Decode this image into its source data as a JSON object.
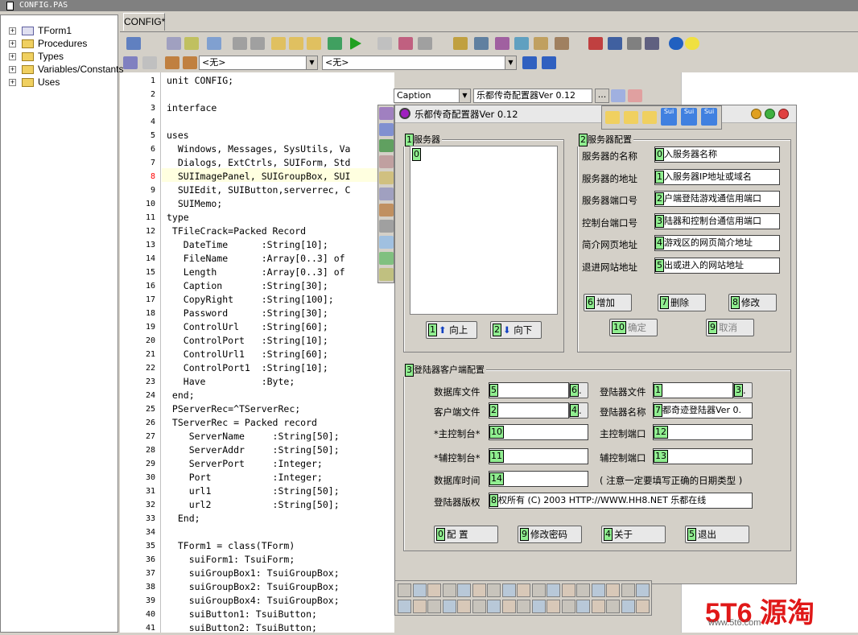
{
  "window": {
    "title": "CONFIG.PAS"
  },
  "tree": {
    "items": [
      "TForm1",
      "Procedures",
      "Types",
      "Variables/Constants",
      "Uses"
    ]
  },
  "tabs": {
    "active": "CONFIG*"
  },
  "combos": {
    "left": "<无>",
    "right": "<无>"
  },
  "code": {
    "line_numbers": [
      "1",
      "2",
      "3",
      "4",
      "5",
      "6",
      "7",
      "8",
      "9",
      "10",
      "11",
      "12",
      "13",
      "14",
      "15",
      "16",
      "17",
      "18",
      "19",
      "20",
      "21",
      "22",
      "23",
      "24",
      "25",
      "26",
      "27",
      "28",
      "29",
      "30",
      "31",
      "32",
      "33",
      "34",
      "35",
      "36",
      "37",
      "38",
      "39",
      "40",
      "41"
    ],
    "lines": [
      "unit CONFIG;",
      "",
      "interface",
      "",
      "uses",
      "  Windows, Messages, SysUtils, Va",
      "  Dialogs, ExtCtrls, SUIForm, Std",
      "  SUIImagePanel, SUIGroupBox, SUI",
      "  SUIEdit, SUIButton,serverrec, C",
      "  SUIMemo;",
      "type",
      " TFileCrack=Packed Record",
      "   DateTime      :String[10];",
      "   FileName      :Array[0..3] of",
      "   Length        :Array[0..3] of",
      "   Caption       :String[30];",
      "   CopyRight     :String[100];",
      "   Password      :String[30];",
      "   ControlUrl    :String[60];",
      "   ControlPort   :String[10];",
      "   ControlUrl1   :String[60];",
      "   ControlPort1  :String[10];",
      "   Have          :Byte;",
      " end;",
      " PServerRec=^TServerRec;",
      " TServerRec = Packed record",
      "    ServerName     :String[50];",
      "    ServerAddr     :String[50];",
      "    ServerPort     :Integer;",
      "    Port           :Integer;",
      "    url1           :String[50];",
      "    url2           :String[50];",
      "  End;",
      "",
      "  TForm1 = class(TForm)",
      "    suiForm1: TsuiForm;",
      "    suiGroupBox1: TsuiGroupBox;",
      "    suiGroupBox2: TsuiGroupBox;",
      "    suiGroupBox4: TsuiGroupBox;",
      "    suiButton1: TsuiButton;",
      "    suiButton2: TsuiButton;"
    ]
  },
  "inspector": {
    "property": "Caption",
    "value": "乐都传奇配置器Ver 0.12",
    "ellipsis": "..."
  },
  "form": {
    "title": "乐都传奇配置器Ver 0.12",
    "group_server": {
      "tag": "1",
      "label": "服务器",
      "list_tag": "0"
    },
    "btn_up": {
      "tag": "1",
      "label": "向上"
    },
    "btn_down": {
      "tag": "2",
      "label": "向下"
    },
    "group_config": {
      "tag": "2",
      "label": "服务器配置"
    },
    "fields": [
      {
        "label": "服务器的名称",
        "tag": "0",
        "value": "入服务器名称"
      },
      {
        "label": "服务器的地址",
        "tag": "1",
        "value": "入服务器IP地址或域名"
      },
      {
        "label": "服务器端口号",
        "tag": "2",
        "value": "户端登陆游戏通信用端口"
      },
      {
        "label": "控制台端口号",
        "tag": "3",
        "value": "陆器和控制台通信用端口"
      },
      {
        "label": "简介网页地址",
        "tag": "4",
        "value": "游戏区的网页简介地址"
      },
      {
        "label": "退进网站地址",
        "tag": "5",
        "value": "出或进入的网站地址"
      }
    ],
    "btn_add": {
      "tag": "6",
      "label": "增加"
    },
    "btn_del": {
      "tag": "7",
      "label": "删除"
    },
    "btn_mod": {
      "tag": "8",
      "label": "修改"
    },
    "btn_ok": {
      "tag": "10",
      "label": "确定"
    },
    "btn_cancel": {
      "tag": "9",
      "label": "取消"
    },
    "group_client": {
      "tag": "3",
      "label": "登陆器客户端配置"
    },
    "db_file": {
      "label": "数据库文件",
      "tag": "5",
      "btn_tag": "6",
      "btn": "."
    },
    "login_file": {
      "label": "登陆器文件",
      "tag": "1",
      "btn_tag": "3",
      "btn": "."
    },
    "client_file": {
      "label": "客户端文件",
      "tag": "2",
      "btn_tag": "4",
      "btn": "."
    },
    "login_name": {
      "label": "登陆器名称",
      "tag": "7",
      "value": "都奇迹登陆器Ver 0."
    },
    "main_console": {
      "label": "*主控制台*",
      "tag": "10"
    },
    "main_port": {
      "label": "主控制端口",
      "tag": "12"
    },
    "aux_console": {
      "label": "*辅控制台*",
      "tag": "11"
    },
    "aux_port": {
      "label": "辅控制端口",
      "tag": "13"
    },
    "db_time": {
      "label": "数据库时间",
      "tag": "14"
    },
    "note": "( 注意一定要填写正确的日期类型 )",
    "copyright": {
      "label": "登陆器版权",
      "tag": "8",
      "value": "权所有 (C) 2003 HTTP://WWW.HH8.NET 乐都在线"
    },
    "btn_config": {
      "tag": "0",
      "label": "配    置"
    },
    "btn_pwd": {
      "tag": "9",
      "label": "修改密码"
    },
    "btn_about": {
      "tag": "4",
      "label": "关于"
    },
    "btn_exit": {
      "tag": "5",
      "label": "退出"
    }
  },
  "toolbar_form": {
    "b1": "Sui",
    "b2": "Sui",
    "b3": "Sui"
  },
  "watermark": {
    "big": "5T6 源淘",
    "small": "www.5t6.com"
  }
}
